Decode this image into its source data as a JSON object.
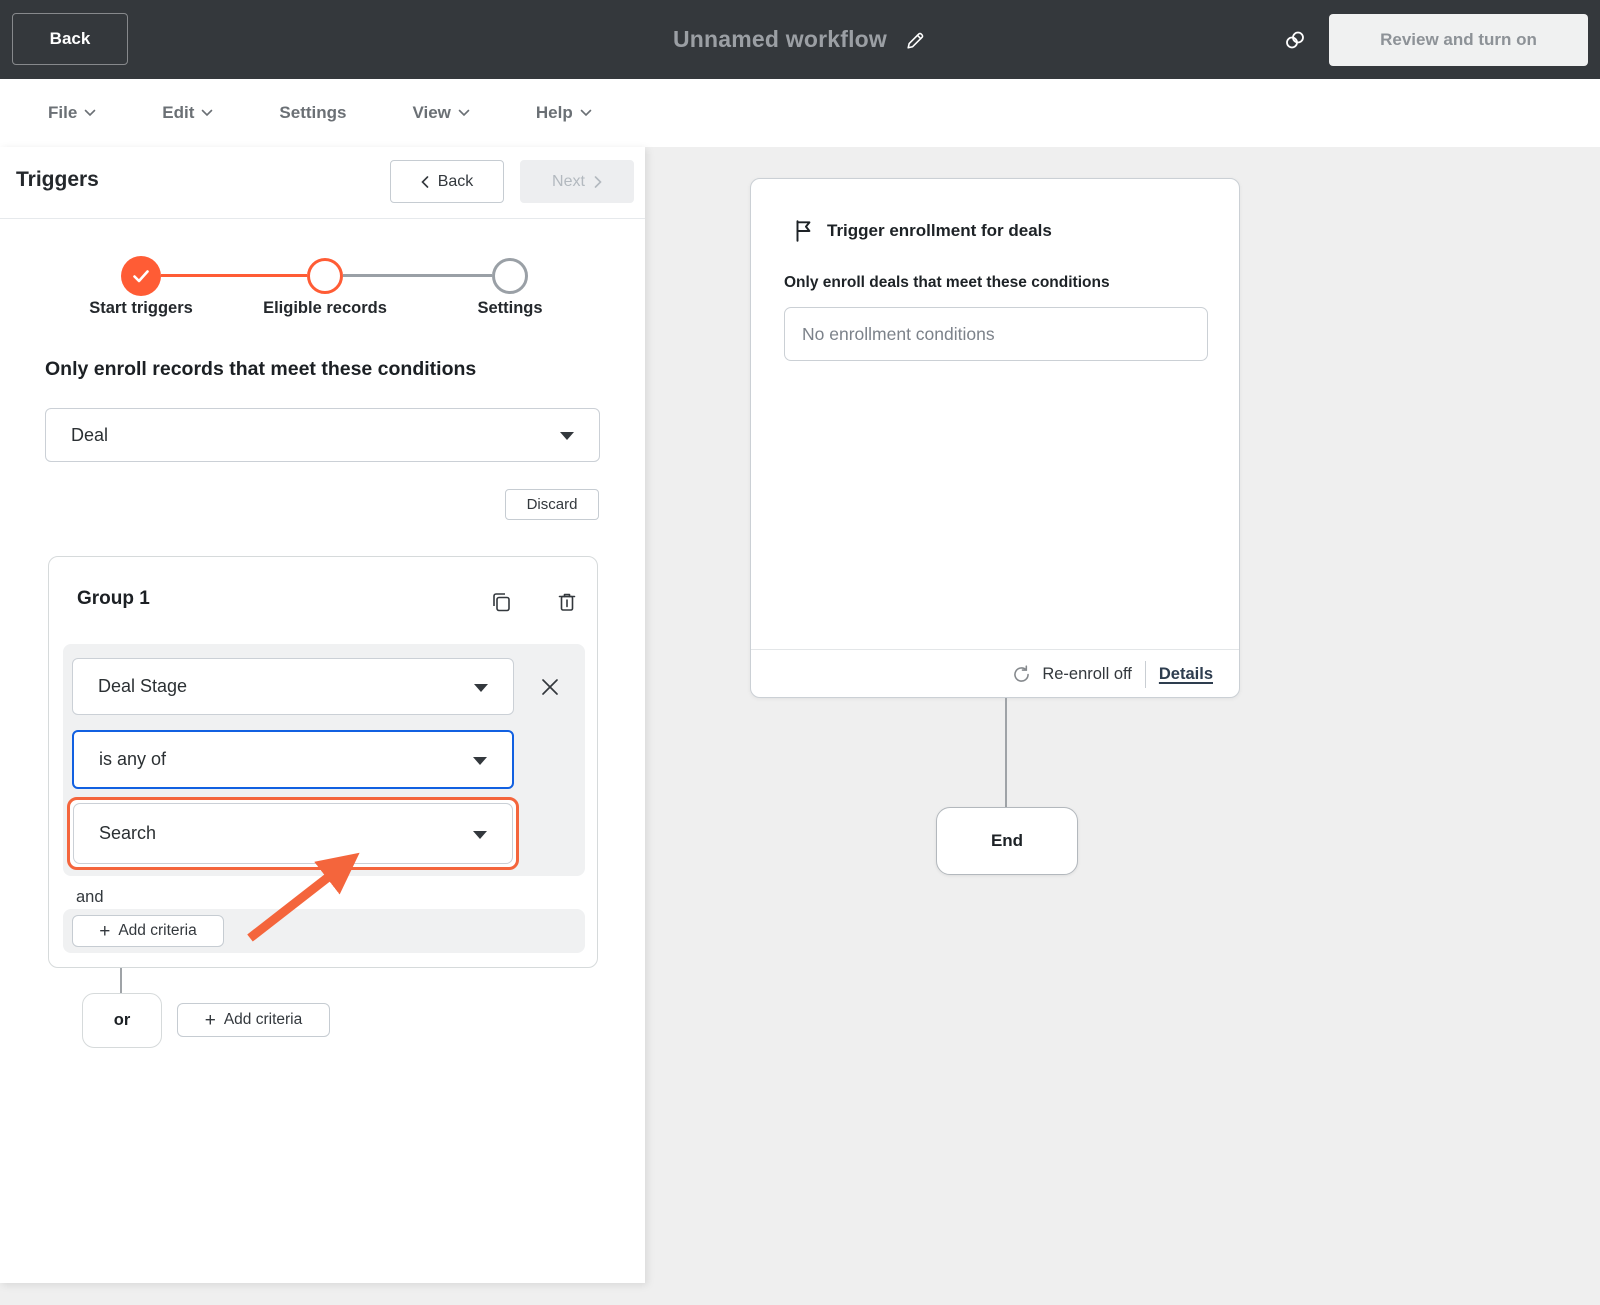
{
  "topbar": {
    "back_label": "Back",
    "title": "Unnamed workflow",
    "review_label": "Review and turn on"
  },
  "menubar": {
    "items": [
      {
        "label": "File",
        "has_chevron": true
      },
      {
        "label": "Edit",
        "has_chevron": true
      },
      {
        "label": "Settings",
        "has_chevron": false
      },
      {
        "label": "View",
        "has_chevron": true
      },
      {
        "label": "Help",
        "has_chevron": true
      }
    ]
  },
  "panel": {
    "title": "Triggers",
    "back_label": "Back",
    "next_label": "Next",
    "stepper": {
      "steps": [
        {
          "label": "Start triggers",
          "state": "complete"
        },
        {
          "label": "Eligible records",
          "state": "active"
        },
        {
          "label": "Settings",
          "state": "upcoming"
        }
      ]
    },
    "conditions_heading": "Only enroll records that meet these conditions",
    "object_select_value": "Deal",
    "discard_label": "Discard",
    "group": {
      "title": "Group 1",
      "filter": {
        "property": "Deal Stage",
        "operator": "is any of",
        "value_placeholder": "Search"
      },
      "and_label": "and",
      "add_criteria_label": "Add criteria"
    },
    "or_label": "or",
    "add_criteria_label": "Add criteria"
  },
  "canvas": {
    "trigger_card": {
      "title": "Trigger enrollment for deals",
      "conditions_heading": "Only enroll deals that meet these conditions",
      "conditions_value": "No enrollment conditions",
      "reenroll_label": "Re-enroll off",
      "details_label": "Details"
    },
    "end_label": "End"
  },
  "icons": {
    "plus": "+"
  },
  "colors": {
    "accent_orange": "#ff5c35",
    "highlight_orange": "#f4653c",
    "focus_blue": "#1160e1",
    "topbar_bg": "#34383c",
    "canvas_bg": "#efefef"
  }
}
